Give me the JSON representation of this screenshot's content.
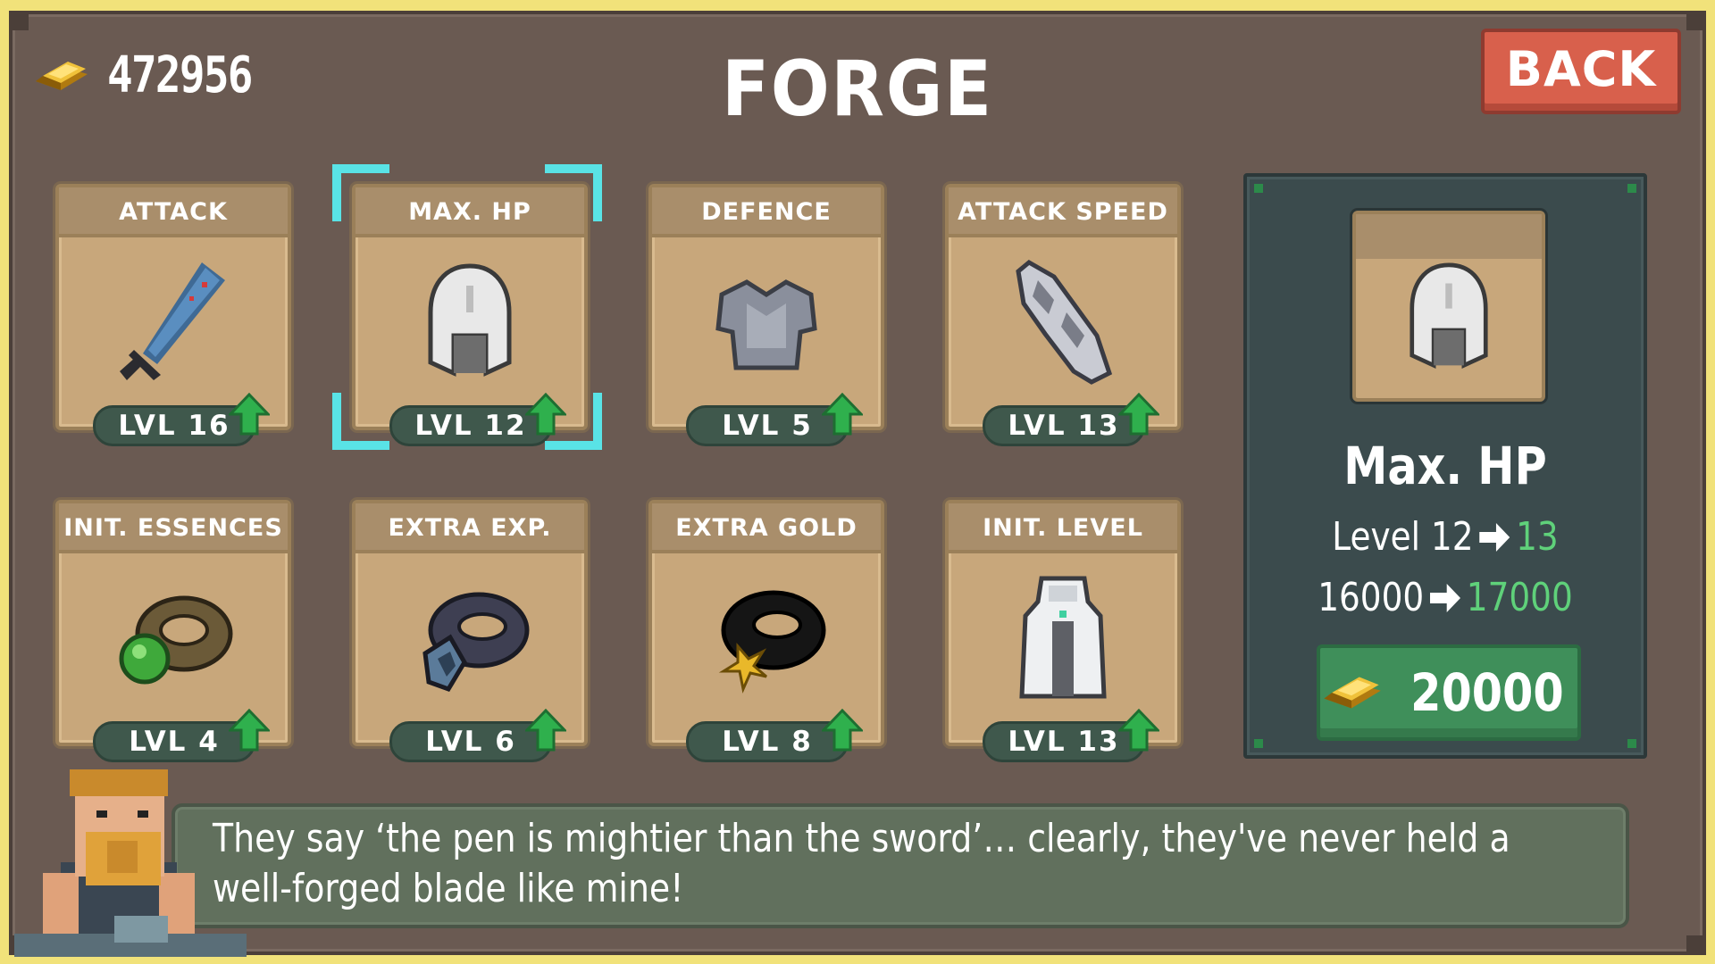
{
  "header": {
    "gold": "472956",
    "title": "FORGE",
    "back_label": "BACK"
  },
  "cards": [
    {
      "label": "ATTACK",
      "level": "LVL 16",
      "icon": "sword-icon",
      "upgradable": true
    },
    {
      "label": "MAX. HP",
      "level": "LVL 12",
      "icon": "helmet-icon",
      "upgradable": true,
      "selected": true
    },
    {
      "label": "DEFENCE",
      "level": "LVL 5",
      "icon": "chest-armor-icon",
      "upgradable": true
    },
    {
      "label": "ATTACK SPEED",
      "level": "LVL 13",
      "icon": "gauntlet-icon",
      "upgradable": true
    },
    {
      "label": "INIT. ESSENCES",
      "level": "LVL 4",
      "icon": "gem-ring-icon",
      "upgradable": true
    },
    {
      "label": "EXTRA EXP.",
      "level": "LVL 6",
      "icon": "rune-ring-icon",
      "upgradable": true
    },
    {
      "label": "EXTRA GOLD",
      "level": "LVL 8",
      "icon": "gold-ring-icon",
      "upgradable": true
    },
    {
      "label": "INIT. LEVEL",
      "level": "LVL 13",
      "icon": "cloak-icon",
      "upgradable": true
    }
  ],
  "detail": {
    "name": "Max. HP",
    "level_prefix": "Level 12",
    "level_next": "13",
    "value_current": "16000",
    "value_next": "17000",
    "cost": "20000"
  },
  "dialogue": {
    "text": "They say ‘the pen is mightier than the sword’… clearly, they've never held a well-forged blade like mine!"
  },
  "colors": {
    "frame": "#6a5a52",
    "card": "#c8a77b",
    "panel": "#3b4b4d",
    "accent_green": "#5fd17a",
    "back_red": "#d8604c",
    "selection": "#59e3e6"
  }
}
